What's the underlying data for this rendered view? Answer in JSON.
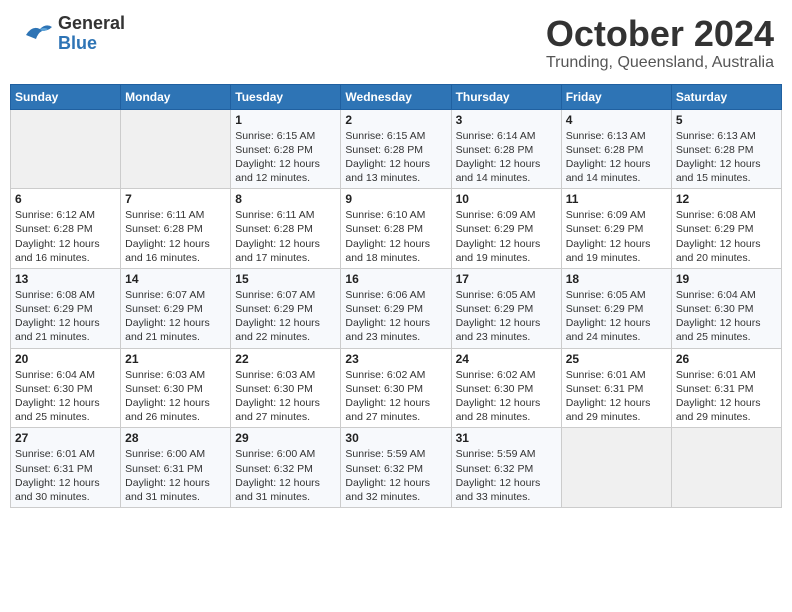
{
  "header": {
    "logo_general": "General",
    "logo_blue": "Blue",
    "month": "October 2024",
    "location": "Trunding, Queensland, Australia"
  },
  "weekdays": [
    "Sunday",
    "Monday",
    "Tuesday",
    "Wednesday",
    "Thursday",
    "Friday",
    "Saturday"
  ],
  "weeks": [
    [
      {
        "day": "",
        "sunrise": "",
        "sunset": "",
        "daylight": ""
      },
      {
        "day": "",
        "sunrise": "",
        "sunset": "",
        "daylight": ""
      },
      {
        "day": "1",
        "sunrise": "Sunrise: 6:15 AM",
        "sunset": "Sunset: 6:28 PM",
        "daylight": "Daylight: 12 hours and 12 minutes."
      },
      {
        "day": "2",
        "sunrise": "Sunrise: 6:15 AM",
        "sunset": "Sunset: 6:28 PM",
        "daylight": "Daylight: 12 hours and 13 minutes."
      },
      {
        "day": "3",
        "sunrise": "Sunrise: 6:14 AM",
        "sunset": "Sunset: 6:28 PM",
        "daylight": "Daylight: 12 hours and 14 minutes."
      },
      {
        "day": "4",
        "sunrise": "Sunrise: 6:13 AM",
        "sunset": "Sunset: 6:28 PM",
        "daylight": "Daylight: 12 hours and 14 minutes."
      },
      {
        "day": "5",
        "sunrise": "Sunrise: 6:13 AM",
        "sunset": "Sunset: 6:28 PM",
        "daylight": "Daylight: 12 hours and 15 minutes."
      }
    ],
    [
      {
        "day": "6",
        "sunrise": "Sunrise: 6:12 AM",
        "sunset": "Sunset: 6:28 PM",
        "daylight": "Daylight: 12 hours and 16 minutes."
      },
      {
        "day": "7",
        "sunrise": "Sunrise: 6:11 AM",
        "sunset": "Sunset: 6:28 PM",
        "daylight": "Daylight: 12 hours and 16 minutes."
      },
      {
        "day": "8",
        "sunrise": "Sunrise: 6:11 AM",
        "sunset": "Sunset: 6:28 PM",
        "daylight": "Daylight: 12 hours and 17 minutes."
      },
      {
        "day": "9",
        "sunrise": "Sunrise: 6:10 AM",
        "sunset": "Sunset: 6:28 PM",
        "daylight": "Daylight: 12 hours and 18 minutes."
      },
      {
        "day": "10",
        "sunrise": "Sunrise: 6:09 AM",
        "sunset": "Sunset: 6:29 PM",
        "daylight": "Daylight: 12 hours and 19 minutes."
      },
      {
        "day": "11",
        "sunrise": "Sunrise: 6:09 AM",
        "sunset": "Sunset: 6:29 PM",
        "daylight": "Daylight: 12 hours and 19 minutes."
      },
      {
        "day": "12",
        "sunrise": "Sunrise: 6:08 AM",
        "sunset": "Sunset: 6:29 PM",
        "daylight": "Daylight: 12 hours and 20 minutes."
      }
    ],
    [
      {
        "day": "13",
        "sunrise": "Sunrise: 6:08 AM",
        "sunset": "Sunset: 6:29 PM",
        "daylight": "Daylight: 12 hours and 21 minutes."
      },
      {
        "day": "14",
        "sunrise": "Sunrise: 6:07 AM",
        "sunset": "Sunset: 6:29 PM",
        "daylight": "Daylight: 12 hours and 21 minutes."
      },
      {
        "day": "15",
        "sunrise": "Sunrise: 6:07 AM",
        "sunset": "Sunset: 6:29 PM",
        "daylight": "Daylight: 12 hours and 22 minutes."
      },
      {
        "day": "16",
        "sunrise": "Sunrise: 6:06 AM",
        "sunset": "Sunset: 6:29 PM",
        "daylight": "Daylight: 12 hours and 23 minutes."
      },
      {
        "day": "17",
        "sunrise": "Sunrise: 6:05 AM",
        "sunset": "Sunset: 6:29 PM",
        "daylight": "Daylight: 12 hours and 23 minutes."
      },
      {
        "day": "18",
        "sunrise": "Sunrise: 6:05 AM",
        "sunset": "Sunset: 6:29 PM",
        "daylight": "Daylight: 12 hours and 24 minutes."
      },
      {
        "day": "19",
        "sunrise": "Sunrise: 6:04 AM",
        "sunset": "Sunset: 6:30 PM",
        "daylight": "Daylight: 12 hours and 25 minutes."
      }
    ],
    [
      {
        "day": "20",
        "sunrise": "Sunrise: 6:04 AM",
        "sunset": "Sunset: 6:30 PM",
        "daylight": "Daylight: 12 hours and 25 minutes."
      },
      {
        "day": "21",
        "sunrise": "Sunrise: 6:03 AM",
        "sunset": "Sunset: 6:30 PM",
        "daylight": "Daylight: 12 hours and 26 minutes."
      },
      {
        "day": "22",
        "sunrise": "Sunrise: 6:03 AM",
        "sunset": "Sunset: 6:30 PM",
        "daylight": "Daylight: 12 hours and 27 minutes."
      },
      {
        "day": "23",
        "sunrise": "Sunrise: 6:02 AM",
        "sunset": "Sunset: 6:30 PM",
        "daylight": "Daylight: 12 hours and 27 minutes."
      },
      {
        "day": "24",
        "sunrise": "Sunrise: 6:02 AM",
        "sunset": "Sunset: 6:30 PM",
        "daylight": "Daylight: 12 hours and 28 minutes."
      },
      {
        "day": "25",
        "sunrise": "Sunrise: 6:01 AM",
        "sunset": "Sunset: 6:31 PM",
        "daylight": "Daylight: 12 hours and 29 minutes."
      },
      {
        "day": "26",
        "sunrise": "Sunrise: 6:01 AM",
        "sunset": "Sunset: 6:31 PM",
        "daylight": "Daylight: 12 hours and 29 minutes."
      }
    ],
    [
      {
        "day": "27",
        "sunrise": "Sunrise: 6:01 AM",
        "sunset": "Sunset: 6:31 PM",
        "daylight": "Daylight: 12 hours and 30 minutes."
      },
      {
        "day": "28",
        "sunrise": "Sunrise: 6:00 AM",
        "sunset": "Sunset: 6:31 PM",
        "daylight": "Daylight: 12 hours and 31 minutes."
      },
      {
        "day": "29",
        "sunrise": "Sunrise: 6:00 AM",
        "sunset": "Sunset: 6:32 PM",
        "daylight": "Daylight: 12 hours and 31 minutes."
      },
      {
        "day": "30",
        "sunrise": "Sunrise: 5:59 AM",
        "sunset": "Sunset: 6:32 PM",
        "daylight": "Daylight: 12 hours and 32 minutes."
      },
      {
        "day": "31",
        "sunrise": "Sunrise: 5:59 AM",
        "sunset": "Sunset: 6:32 PM",
        "daylight": "Daylight: 12 hours and 33 minutes."
      },
      {
        "day": "",
        "sunrise": "",
        "sunset": "",
        "daylight": ""
      },
      {
        "day": "",
        "sunrise": "",
        "sunset": "",
        "daylight": ""
      }
    ]
  ]
}
